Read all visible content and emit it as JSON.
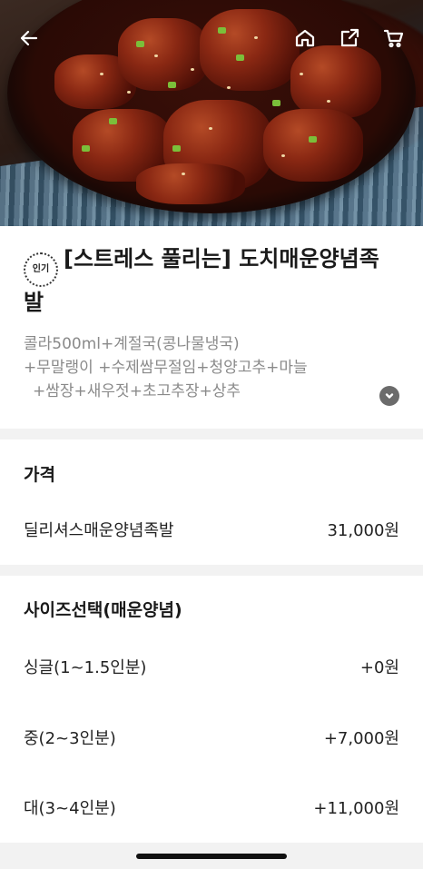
{
  "product": {
    "badge": "인기",
    "title_line1": "[스트레스 풀리는] 도치매운양념족",
    "title_line2": "발",
    "description": [
      "콜라500ml+계절국(콩나물냉국)",
      "+무말랭이 +수제쌈무절임+청양고추+마늘",
      "+쌈장+새우젓+초고추장+상추"
    ]
  },
  "price_section": {
    "title": "가격",
    "item_name": "딜리셔스매운양념족발",
    "item_price": "31,000원"
  },
  "size_section": {
    "title": "사이즈선택(매운양념)",
    "options": [
      {
        "label": "싱글(1~1.5인분)",
        "price": "+0원"
      },
      {
        "label": "중(2~3인분)",
        "price": "+7,000원"
      },
      {
        "label": "대(3~4인분)",
        "price": "+11,000원"
      }
    ]
  },
  "icons": {
    "back": "back-arrow-icon",
    "home": "home-icon",
    "share": "share-icon",
    "cart": "cart-icon",
    "expand": "chevron-down-icon"
  }
}
